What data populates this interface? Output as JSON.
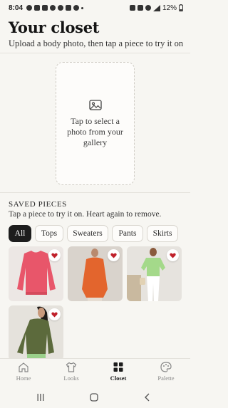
{
  "status_bar": {
    "time": "8:04",
    "battery": "12%"
  },
  "header": {
    "title": "Your closet",
    "subtitle": "Upload a body photo, then tap a piece to try it on"
  },
  "upload": {
    "icon": "image-icon",
    "text": "Tap to select a photo from your gallery"
  },
  "saved": {
    "heading": "SAVED PIECES",
    "hint": "Tap a piece to try it on. Heart again to remove."
  },
  "filters": [
    {
      "label": "All",
      "active": true
    },
    {
      "label": "Tops",
      "active": false
    },
    {
      "label": "Sweaters",
      "active": false
    },
    {
      "label": "Pants",
      "active": false
    },
    {
      "label": "Skirts",
      "active": false
    }
  ],
  "pieces": [
    {
      "name": "pink-knit-sweater",
      "bg": "#ece7e4",
      "garment": "#e8566a",
      "favorited": true
    },
    {
      "name": "orange-knit-sweater",
      "bg": "#d9d3cc",
      "garment": "#e3652d",
      "favorited": true
    },
    {
      "name": "green-top-white-pants",
      "bg": "#e6e3de",
      "garment": "#a4d98a",
      "favorited": true
    },
    {
      "name": "olive-knit-sweater",
      "bg": "#e5e2dc",
      "garment": "#5c6a3c",
      "favorited": true
    }
  ],
  "colors": {
    "heart": "#c0202a",
    "active_chip": "#1d1d1d"
  },
  "nav": [
    {
      "label": "Home",
      "icon": "home-icon",
      "active": false
    },
    {
      "label": "Looks",
      "icon": "shirt-icon",
      "active": false
    },
    {
      "label": "Closet",
      "icon": "grid-icon",
      "active": true
    },
    {
      "label": "Palette",
      "icon": "palette-icon",
      "active": false
    }
  ]
}
